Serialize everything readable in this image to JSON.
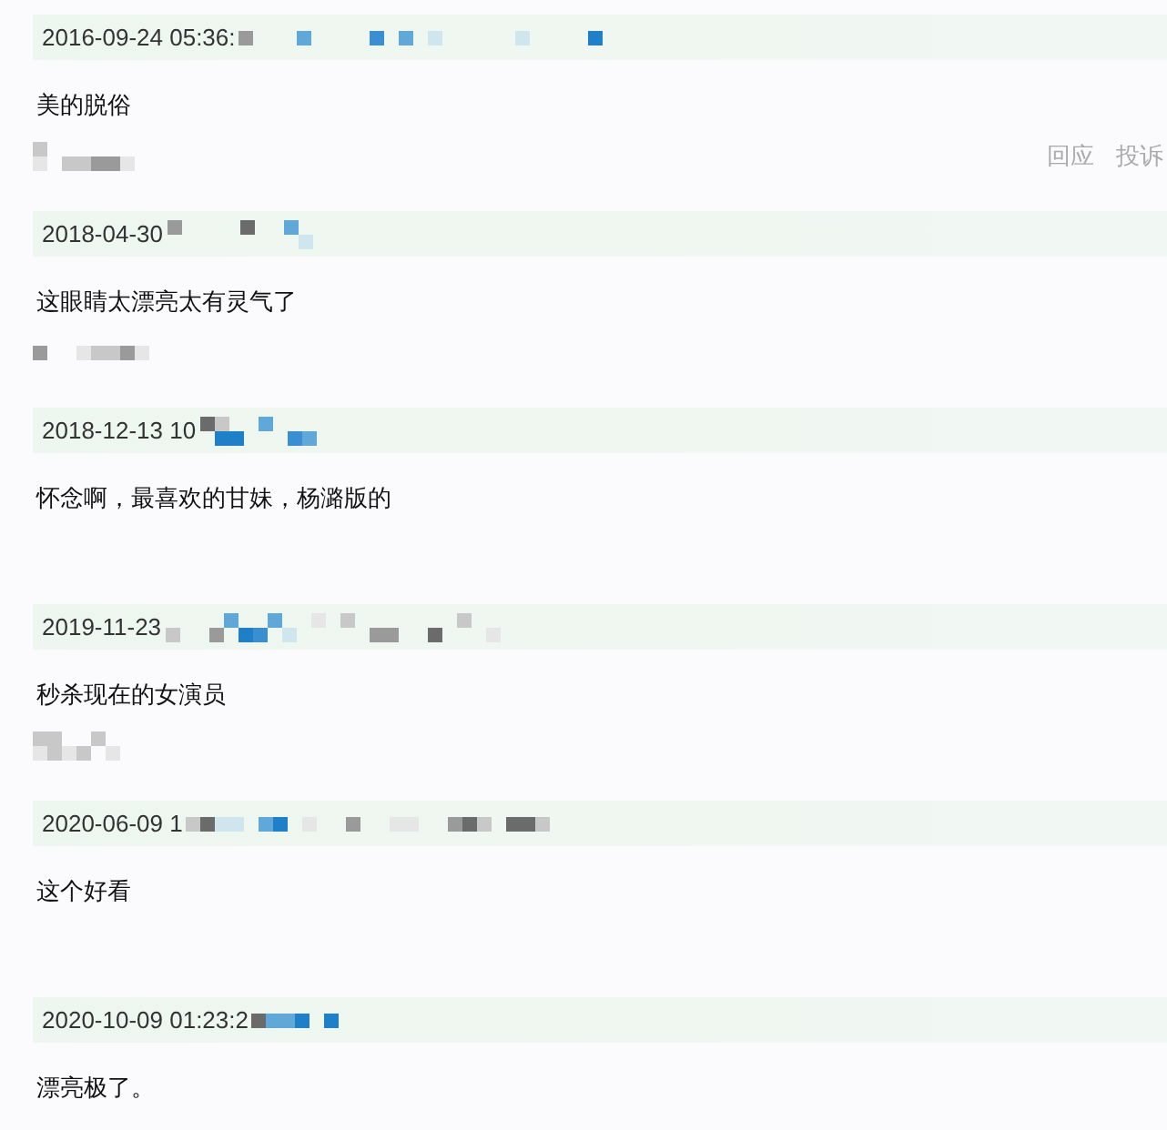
{
  "comments": [
    {
      "time": "2016-09-24 05:36:",
      "text": "美的脱俗",
      "footer_shown": true,
      "actions": [
        "回应",
        "投诉"
      ]
    },
    {
      "time": "2018-04-30",
      "text": "这眼睛太漂亮太有灵气了",
      "footer_shown": true
    },
    {
      "time": "2018-12-13 10",
      "text": "怀念啊，最喜欢的甘妹，杨潞版的",
      "footer_shown": false
    },
    {
      "time": "2019-11-23",
      "text": "秒杀现在的女演员",
      "footer_shown": true
    },
    {
      "time": "2020-06-09 1",
      "text": "这个好看",
      "footer_shown": false
    },
    {
      "time": "2020-10-09 01:23:2",
      "text": "漂亮极了。",
      "footer_shown": false
    }
  ]
}
